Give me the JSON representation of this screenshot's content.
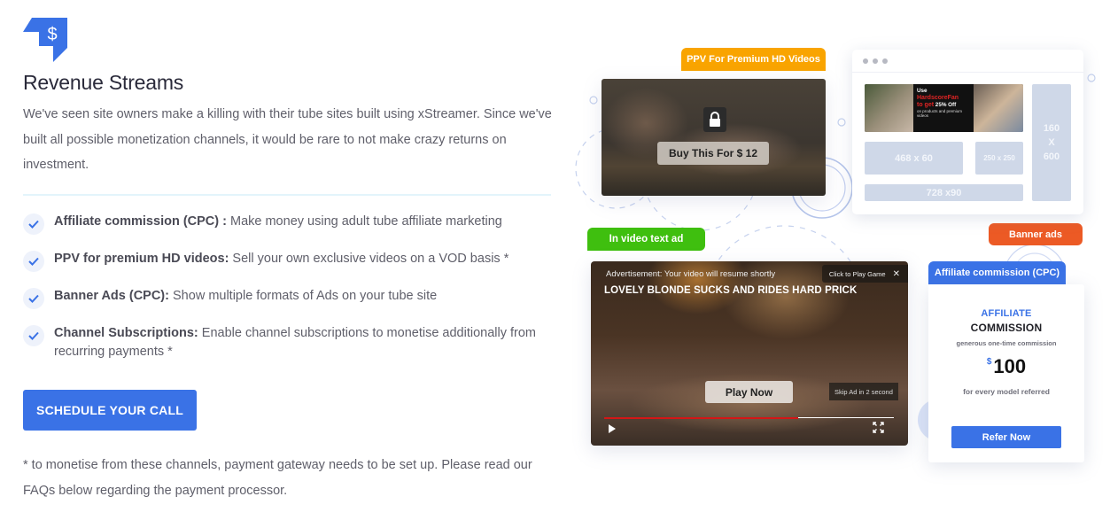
{
  "section": {
    "icon": "dollar-bookmark-icon",
    "title": "Revenue Streams",
    "intro": "We've seen site owners make a killing with their tube sites built using xStreamer. Since we've built all possible monetization channels, it would be rare to not make crazy returns on investment.",
    "features": [
      {
        "icon": "check-icon",
        "label": "Affiliate commission (CPC) :",
        "text": " Make money using adult tube affiliate marketing"
      },
      {
        "icon": "check-icon",
        "label": "PPV for premium HD videos:",
        "text": " Sell your own exclusive videos on a VOD basis *"
      },
      {
        "icon": "check-icon",
        "label": "Banner Ads (CPC):",
        "text": " Show multiple formats of Ads on your tube site"
      },
      {
        "icon": "check-icon",
        "label": "Channel Subscriptions:",
        "text": " Enable channel subscriptions to monetise additionally from recurring payments *"
      }
    ],
    "cta_label": "SCHEDULE YOUR CALL",
    "footnote": "* to monetise from these channels, payment gateway needs to be set up. Please read our FAQs below regarding the payment processor."
  },
  "illustration": {
    "ppv": {
      "tag": "PPV For Premium HD Videos",
      "lock_icon": "lock-icon",
      "buy_label": "Buy This For  $ 12"
    },
    "banner": {
      "tag": "Banner ads",
      "promo": {
        "line1": "Use",
        "line2": "HardscoreFan",
        "line3_red": "to get",
        "line3": " 25% Off",
        "line4": "on products and premium videos"
      },
      "slots": {
        "s468": "468 x 60",
        "s250": "250 x 250",
        "s728": "728 x90",
        "s160_a": "160",
        "s160_b": "X",
        "s160_c": "600"
      }
    },
    "video": {
      "tag": "In video text ad",
      "ad_text": "Advertisement: Your video will resume shortly",
      "title": "LOVELY BLONDE SUCKS AND RIDES HARD PRICK",
      "game_label": "Click to Play Game",
      "close_glyph": "✕",
      "play_label": "Play Now",
      "skip_label": "Skip Ad in 2 second",
      "progress_percent": 67,
      "colors": {
        "progress": "#d41616"
      }
    },
    "affiliate": {
      "tag": "Affiliate commission (CPC)",
      "heading1": "AFFILIATE",
      "heading2": "COMMISSION",
      "sub": "generous one-time commission",
      "currency": "$",
      "amount": "100",
      "note": "for every model referred",
      "button": "Refer Now"
    }
  },
  "colors": {
    "accent": "#3a72e6",
    "ppv_tag": "#f9a400",
    "invideo_tag": "#3fbf0f",
    "banner_tag": "#ec5a25"
  }
}
